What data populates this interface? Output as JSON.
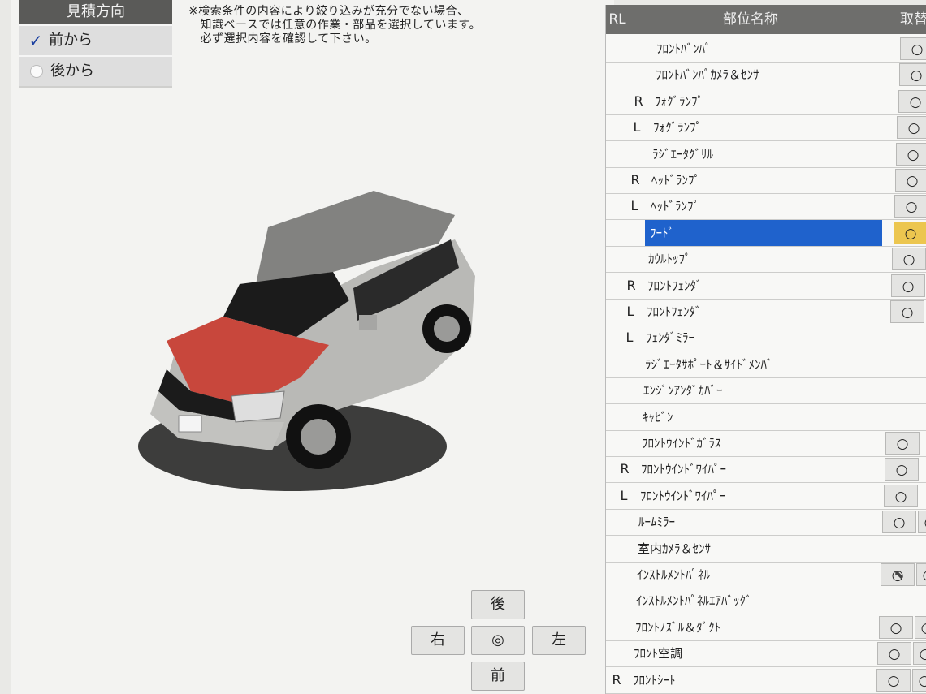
{
  "view_direction": {
    "title": "見積方向",
    "options": [
      {
        "label": "前から",
        "checked": true
      },
      {
        "label": "後から",
        "checked": false
      }
    ]
  },
  "notice": "※検索条件の内容により絞り込みが充分でない場合、\n　知識ベースでは任意の作業・部品を選択しています。\n　必ず選択内容を確認して下さい。",
  "nav": {
    "rear": "後",
    "right": "右",
    "center": "◎",
    "left": "左",
    "front": "前"
  },
  "table": {
    "headers": {
      "rl": "RL",
      "name": "部位名称",
      "action": "取替"
    },
    "rows": [
      {
        "rl": "",
        "name": "ﾌﾛﾝﾄﾊﾞﾝﾊﾟ",
        "mark": "○",
        "mark2": ""
      },
      {
        "rl": "",
        "name": "ﾌﾛﾝﾄﾊﾞﾝﾊﾟｶﾒﾗ＆ｾﾝｻ",
        "mark": "○",
        "mark2": ""
      },
      {
        "rl": "R",
        "name": "ﾌｫｸﾞﾗﾝﾌﾟ",
        "mark": "○",
        "mark2": ""
      },
      {
        "rl": "L",
        "name": "ﾌｫｸﾞﾗﾝﾌﾟ",
        "mark": "○",
        "mark2": ""
      },
      {
        "rl": "",
        "name": "ﾗｼﾞｴｰﾀｸﾞﾘﾙ",
        "mark": "○",
        "mark2": ""
      },
      {
        "rl": "R",
        "name": "ﾍｯﾄﾞﾗﾝﾌﾟ",
        "mark": "○",
        "mark2": ""
      },
      {
        "rl": "L",
        "name": "ﾍｯﾄﾞﾗﾝﾌﾟ",
        "mark": "○",
        "mark2": ""
      },
      {
        "rl": "",
        "name": "ﾌｰﾄﾞ",
        "mark": "○",
        "mark2": "",
        "selected": true
      },
      {
        "rl": "",
        "name": "ｶｳﾙﾄｯﾌﾟ",
        "mark": "○",
        "mark2": ""
      },
      {
        "rl": "R",
        "name": "ﾌﾛﾝﾄﾌｪﾝﾀﾞ",
        "mark": "○",
        "mark2": ""
      },
      {
        "rl": "L",
        "name": "ﾌﾛﾝﾄﾌｪﾝﾀﾞ",
        "mark": "○",
        "mark2": ""
      },
      {
        "rl": "L",
        "name": "ﾌｪﾝﾀﾞﾐﾗｰ",
        "mark": "",
        "mark2": ""
      },
      {
        "rl": "",
        "name": "ﾗｼﾞｴｰﾀｻﾎﾟｰﾄ＆ｻｲﾄﾞﾒﾝﾊﾞ",
        "mark": "",
        "mark2": ""
      },
      {
        "rl": "",
        "name": "ｴﾝｼﾞﾝｱﾝﾀﾞｶﾊﾞｰ",
        "mark": "",
        "mark2": ""
      },
      {
        "rl": "",
        "name": "ｷｬﾋﾞﾝ",
        "mark": "",
        "mark2": ""
      },
      {
        "rl": "",
        "name": "ﾌﾛﾝﾄｳｲﾝﾄﾞｶﾞﾗｽ",
        "mark": "○",
        "mark2": ""
      },
      {
        "rl": "R",
        "name": "ﾌﾛﾝﾄｳｲﾝﾄﾞﾜｲﾊﾟｰ",
        "mark": "○",
        "mark2": ""
      },
      {
        "rl": "L",
        "name": "ﾌﾛﾝﾄｳｲﾝﾄﾞﾜｲﾊﾟｰ",
        "mark": "○",
        "mark2": ""
      },
      {
        "rl": "",
        "name": "ﾙｰﾑﾐﾗｰ",
        "mark": "○",
        "mark2": "○"
      },
      {
        "rl": "",
        "name": "室内ｶﾒﾗ＆ｾﾝｻ",
        "mark": "",
        "mark2": ""
      },
      {
        "rl": "",
        "name": "ｲﾝｽﾄﾙﾒﾝﾄﾊﾟﾈﾙ",
        "mark": "○",
        "mark2": "○"
      },
      {
        "rl": "",
        "name": "ｲﾝｽﾄﾙﾒﾝﾄﾊﾟﾈﾙｴｱﾊﾞｯｸﾞ",
        "mark": "",
        "mark2": ""
      },
      {
        "rl": "",
        "name": "ﾌﾛﾝﾄﾉｽﾞﾙ＆ﾀﾞｸﾄ",
        "mark": "○",
        "mark2": "○"
      },
      {
        "rl": "",
        "name": "ﾌﾛﾝﾄ空調",
        "mark": "○",
        "mark2": "○"
      },
      {
        "rl": "R",
        "name": "ﾌﾛﾝﾄｼｰﾄ",
        "mark": "○",
        "mark2": "○"
      }
    ]
  },
  "colors": {
    "selected": "#1f62cc",
    "active_mark": "#ecc64f",
    "hood": "#c8473c",
    "body": "#b9b9b6"
  }
}
